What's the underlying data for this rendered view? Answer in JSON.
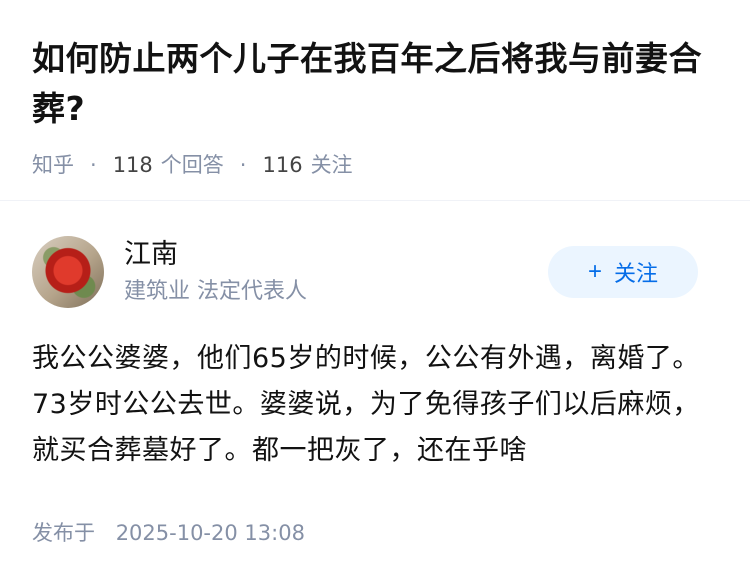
{
  "question": {
    "title": "如何防止两个儿子在我百年之后将我与前妻合葬?",
    "source": "知乎",
    "answer_count_num": "118",
    "answer_count_label": "个回答",
    "follower_count_num": "116",
    "follower_count_label": "关注"
  },
  "author": {
    "name": "江南",
    "headline": "建筑业 法定代表人",
    "follow_label": "关注",
    "follow_icon": "plus-icon"
  },
  "answer": {
    "content": "我公公婆婆，他们65岁的时候，公公有外遇，离婚了。73岁时公公去世。婆婆说，为了免得孩子们以后麻烦，就买合葬墓好了。都一把灰了，还在乎啥",
    "published_label": "发布于",
    "published_time": "2025-10-20 13:08"
  },
  "colors": {
    "meta_gray": "#8590a6",
    "accent_blue": "#056de8",
    "follow_bg": "#ebf5ff"
  }
}
